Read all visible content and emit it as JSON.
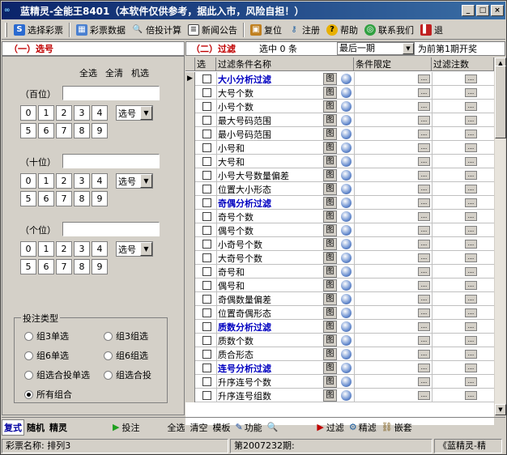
{
  "window": {
    "title": "蓝精灵-全能王8401（本软件仅供参考，据此入市，风险自担！）",
    "app_icon": "∞"
  },
  "toolbar": {
    "items": [
      "选择彩票",
      "彩票数据",
      "倍投计算",
      "新闻公告",
      "复位",
      "注册",
      "帮助",
      "联系我们",
      "退"
    ]
  },
  "left": {
    "section_title": "（一）选号",
    "select_all": "全选",
    "clear_all": "全清",
    "random": "机选",
    "groups": [
      {
        "label": "（百位）",
        "dropdown": "选号"
      },
      {
        "label": "（十位）",
        "dropdown": "选号"
      },
      {
        "label": "（个位）",
        "dropdown": "选号"
      }
    ],
    "digits": [
      "0",
      "1",
      "2",
      "3",
      "4",
      "5",
      "6",
      "7",
      "8",
      "9"
    ],
    "bet_type": {
      "caption": "投注类型",
      "options": [
        "组3单选",
        "组3组选",
        "组6单选",
        "组6组选",
        "组选合投单选",
        "组选合投",
        "所有组合"
      ],
      "selected": "所有组合"
    }
  },
  "right": {
    "section_title": "（二）过滤",
    "selected_count": "选中 0 条",
    "period_select": "最后一期",
    "period_note": "为前第1期开奖",
    "columns": [
      "选",
      "过滤条件名称",
      "条件限定",
      "过滤注数"
    ],
    "rows": [
      {
        "name": "大小分析过滤",
        "heading": true
      },
      {
        "name": "大号个数",
        "heading": false
      },
      {
        "name": "小号个数",
        "heading": false
      },
      {
        "name": "最大号码范围",
        "heading": false
      },
      {
        "name": "最小号码范围",
        "heading": false
      },
      {
        "name": "小号和",
        "heading": false
      },
      {
        "name": "大号和",
        "heading": false
      },
      {
        "name": "小号大号数量偏差",
        "heading": false
      },
      {
        "name": "位置大小形态",
        "heading": false
      },
      {
        "name": "奇偶分析过滤",
        "heading": true
      },
      {
        "name": "奇号个数",
        "heading": false
      },
      {
        "name": "偶号个数",
        "heading": false
      },
      {
        "name": "小奇号个数",
        "heading": false
      },
      {
        "name": "大奇号个数",
        "heading": false
      },
      {
        "name": "奇号和",
        "heading": false
      },
      {
        "name": "偶号和",
        "heading": false
      },
      {
        "name": "奇偶数量偏差",
        "heading": false
      },
      {
        "name": "位置奇偶形态",
        "heading": false
      },
      {
        "name": "质数分析过滤",
        "heading": true
      },
      {
        "name": "质数个数",
        "heading": false
      },
      {
        "name": "质合形态",
        "heading": false
      },
      {
        "name": "连号分析过滤",
        "heading": true
      },
      {
        "name": "升序连号个数",
        "heading": false
      },
      {
        "name": "升序连号组数",
        "heading": false
      }
    ],
    "chart_btn": "图"
  },
  "bottom": {
    "left_tabs": [
      "复式",
      "随机",
      "精灵"
    ],
    "bet_button": "投注",
    "actions": [
      "全选",
      "清空",
      "模板",
      "功能"
    ],
    "filter": "过滤",
    "fine_filter": "精滤",
    "nest": "嵌套"
  },
  "status": {
    "lottery": "彩票名称: 排列3",
    "period": "第2007232期:",
    "app": "《蓝精灵-精"
  }
}
